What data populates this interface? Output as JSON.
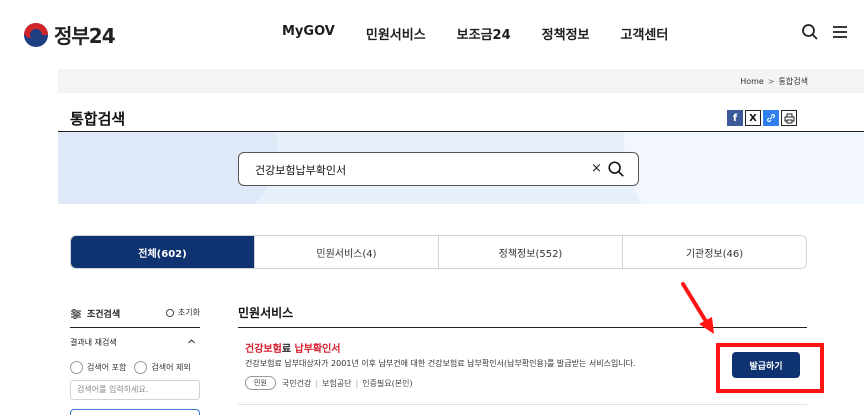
{
  "header": {
    "logo_text": "정부24",
    "nav": [
      "MyGOV",
      "민원서비스",
      "보조금24",
      "정책정보",
      "고객센터"
    ]
  },
  "breadcrumb": {
    "home": "Home",
    "sep": ">",
    "current": "통합검색"
  },
  "page_title": "통합검색",
  "search": {
    "value": "건강보험납부확인서",
    "clear": "×"
  },
  "tabs": [
    "전체(602)",
    "민원서비스(4)",
    "정책정보(552)",
    "기관정보(46)"
  ],
  "filter": {
    "title": "조건검색",
    "reset": "초기화",
    "research_label": "결과내 재검색",
    "research_chevron": "^",
    "include_label": "검색어 포함",
    "exclude_label": "검색어 제외",
    "input_placeholder": "검색어를 입력하세요."
  },
  "results": {
    "section_title": "민원서비스",
    "item": {
      "title_hl1": "건강보험",
      "title_mid": "료 ",
      "title_hl2": "납부확인서",
      "desc": "건강보험료 납부대상자가 2001년 이후 납부건에 대한 건강보험료 납부확인서(납부확인용)를 발급받는 서비스입니다.",
      "tag": "민원",
      "meta1": "국민건강",
      "meta2": "보험공단",
      "meta3": "인증필요(본인)",
      "button": "발급하기"
    }
  },
  "colors": {
    "primary": "#0f3270",
    "highlight": "#d6202e",
    "annotation": "#ff1414"
  }
}
